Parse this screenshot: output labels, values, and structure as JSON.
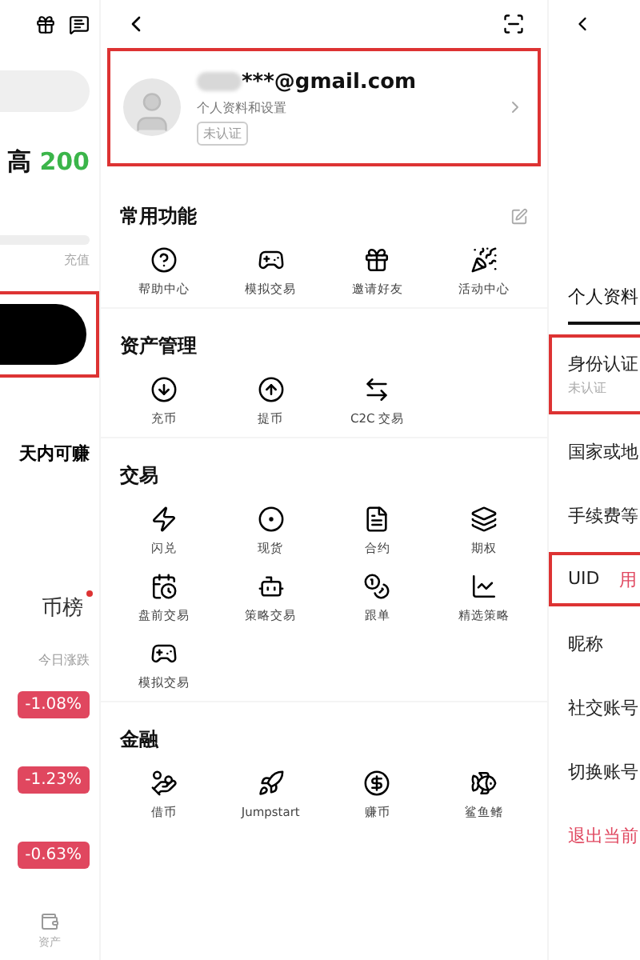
{
  "left_panel": {
    "headline": "高",
    "amount": "200",
    "progress_label": "充值",
    "earn_text": "天内可赚",
    "ranking_title": "币榜",
    "change_header": "今日涨跌",
    "changes": [
      "-1.08%",
      "-1.23%",
      "-0.63%"
    ],
    "tab_label": "资产"
  },
  "menu": {
    "account": {
      "email": "***@gmail.com",
      "subtitle": "个人资料和设置",
      "badge": "未认证",
      "highlighted": true
    },
    "sections": [
      {
        "title": "常用功能",
        "items": [
          "帮助中心",
          "模拟交易",
          "邀请好友",
          "活动中心"
        ]
      },
      {
        "title": "资产管理",
        "items": [
          "充币",
          "提币",
          "C2C 交易"
        ]
      },
      {
        "title": "交易",
        "items": [
          "闪兑",
          "现货",
          "合约",
          "期权",
          "盘前交易",
          "策略交易",
          "跟单",
          "精选策略",
          "模拟交易"
        ]
      },
      {
        "title": "金融",
        "items": [
          "借币",
          "Jumpstart",
          "赚币",
          "鲨鱼鳍"
        ]
      }
    ]
  },
  "profile": {
    "tabs": [
      {
        "label": "个人资料",
        "selected": true
      }
    ],
    "rows": [
      {
        "kind": "normal",
        "label": "身份认证",
        "sub": "未认证",
        "highlighted": true
      },
      {
        "kind": "normal",
        "label": "国家或地",
        "highlighted": false
      },
      {
        "kind": "normal",
        "label": "手续费等",
        "highlighted": false
      },
      {
        "kind": "normal",
        "label": "UID",
        "value": "用",
        "highlighted": true
      },
      {
        "kind": "normal",
        "label": "昵称",
        "highlighted": false
      },
      {
        "kind": "normal",
        "label": "社交账号",
        "highlighted": false
      },
      {
        "kind": "normal",
        "label": "切换账号",
        "highlighted": false
      },
      {
        "kind": "danger",
        "label": "退出当前",
        "highlighted": false
      }
    ]
  }
}
